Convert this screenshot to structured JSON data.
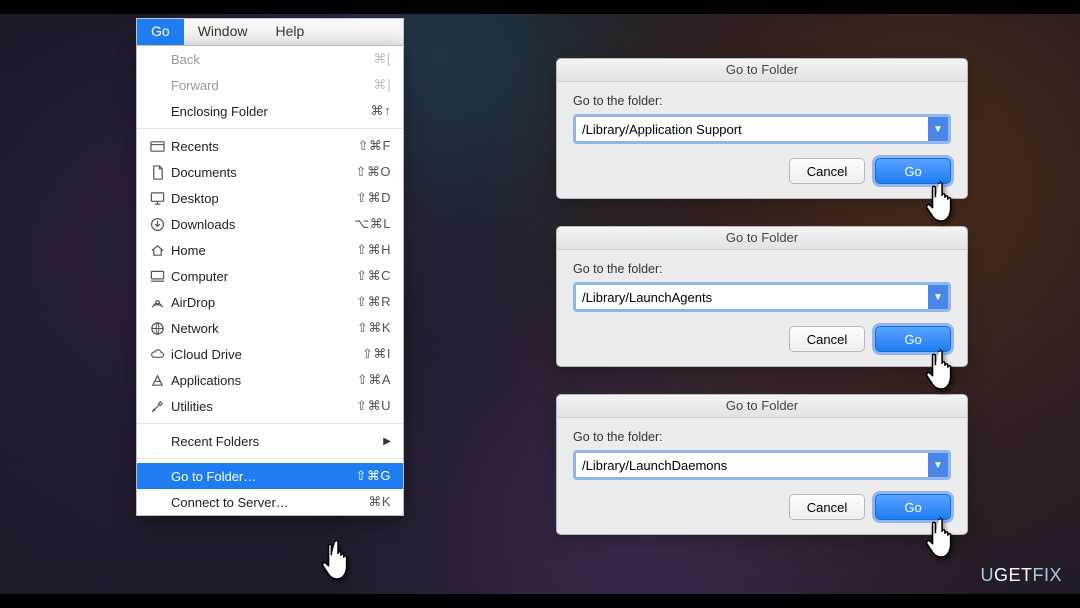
{
  "menubar": {
    "go": "Go",
    "window": "Window",
    "help": "Help"
  },
  "menu": {
    "back": "Back",
    "back_sc": "⌘[",
    "forward": "Forward",
    "forward_sc": "⌘]",
    "enclosing": "Enclosing Folder",
    "enclosing_sc": "⌘↑",
    "recents": "Recents",
    "recents_sc": "⇧⌘F",
    "documents": "Documents",
    "documents_sc": "⇧⌘O",
    "desktop": "Desktop",
    "desktop_sc": "⇧⌘D",
    "downloads": "Downloads",
    "downloads_sc": "⌥⌘L",
    "home": "Home",
    "home_sc": "⇧⌘H",
    "computer": "Computer",
    "computer_sc": "⇧⌘C",
    "airdrop": "AirDrop",
    "airdrop_sc": "⇧⌘R",
    "network": "Network",
    "network_sc": "⇧⌘K",
    "icloud": "iCloud Drive",
    "icloud_sc": "⇧⌘I",
    "applications": "Applications",
    "applications_sc": "⇧⌘A",
    "utilities": "Utilities",
    "utilities_sc": "⇧⌘U",
    "recent_folders": "Recent Folders",
    "go_to_folder": "Go to Folder…",
    "go_to_folder_sc": "⇧⌘G",
    "connect_server": "Connect to Server…",
    "connect_server_sc": "⌘K"
  },
  "dialog_title": "Go to Folder",
  "dialog_label": "Go to the folder:",
  "dialog_cancel": "Cancel",
  "dialog_go": "Go",
  "dialogs": {
    "d1": {
      "value": "/Library/Application Support"
    },
    "d2": {
      "value": "/Library/LaunchAgents"
    },
    "d3": {
      "value": "/Library/LaunchDaemons"
    }
  },
  "watermark_a": "U",
  "watermark_b": "GET",
  "watermark_c": "FIX"
}
